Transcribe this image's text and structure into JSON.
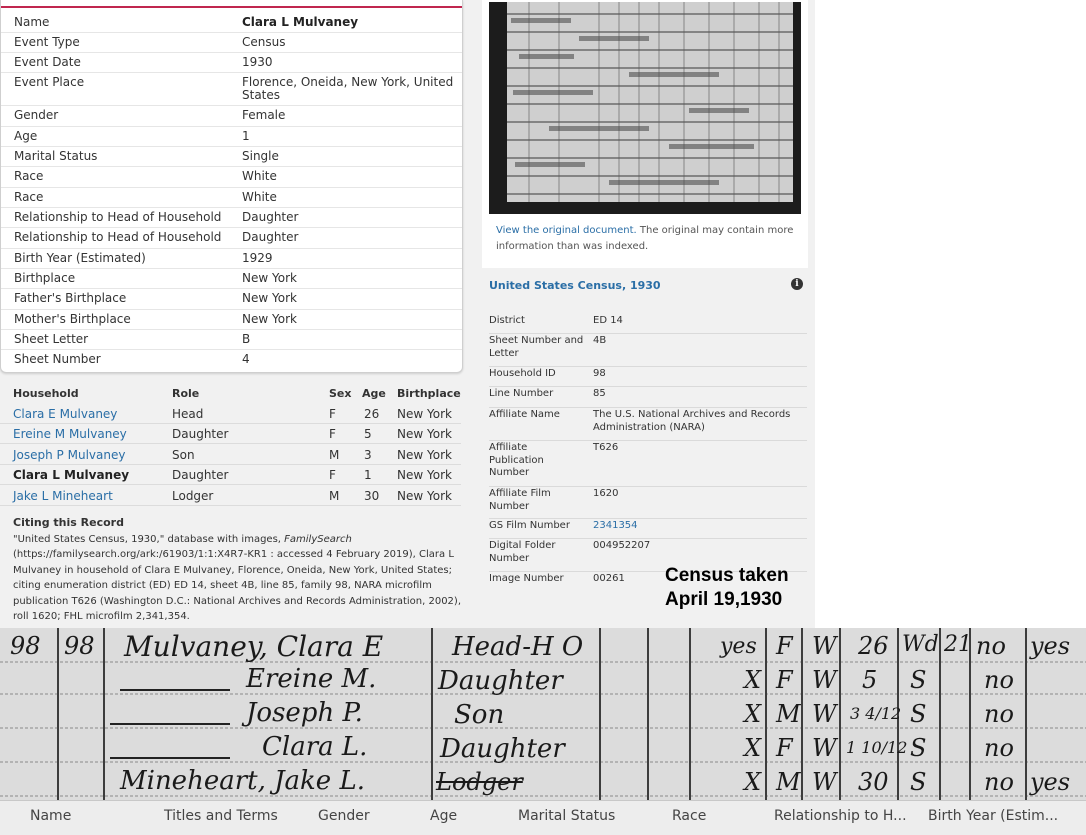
{
  "details": [
    {
      "label": "Name",
      "value": "Clara L Mulvaney",
      "bold": true
    },
    {
      "label": "Event Type",
      "value": "Census"
    },
    {
      "label": "Event Date",
      "value": "1930"
    },
    {
      "label": "Event Place",
      "value": "Florence, Oneida, New York, United States"
    },
    {
      "label": "Gender",
      "value": "Female"
    },
    {
      "label": "Age",
      "value": "1"
    },
    {
      "label": "Marital Status",
      "value": "Single"
    },
    {
      "label": "Race",
      "value": "White"
    },
    {
      "label": "Race",
      "value": "White"
    },
    {
      "label": "Relationship to Head of Household",
      "value": "Daughter"
    },
    {
      "label": "Relationship to Head of Household",
      "value": "Daughter"
    },
    {
      "label": "Birth Year (Estimated)",
      "value": "1929"
    },
    {
      "label": "Birthplace",
      "value": "New York"
    },
    {
      "label": "Father's Birthplace",
      "value": "New York"
    },
    {
      "label": "Mother's Birthplace",
      "value": "New York"
    },
    {
      "label": "Sheet Letter",
      "value": "B"
    },
    {
      "label": "Sheet Number",
      "value": "4"
    }
  ],
  "household": {
    "headers": {
      "name": "Household",
      "role": "Role",
      "sex": "Sex",
      "age": "Age",
      "birthplace": "Birthplace"
    },
    "rows": [
      {
        "name": "Clara E Mulvaney",
        "role": "Head",
        "sex": "F",
        "age": "26",
        "birthplace": "New York"
      },
      {
        "name": "Ereine M Mulvaney",
        "role": "Daughter",
        "sex": "F",
        "age": "5",
        "birthplace": "New York"
      },
      {
        "name": "Joseph P Mulvaney",
        "role": "Son",
        "sex": "M",
        "age": "3",
        "birthplace": "New York"
      },
      {
        "name": "Clara L Mulvaney",
        "role": "Daughter",
        "sex": "F",
        "age": "1",
        "birthplace": "New York",
        "current": true
      },
      {
        "name": "Jake L Mineheart",
        "role": "Lodger",
        "sex": "M",
        "age": "30",
        "birthplace": "New York"
      }
    ]
  },
  "citing": {
    "title": "Citing this Record",
    "text_before": "\"United States Census, 1930,\" database with images, ",
    "text_italic": "FamilySearch",
    "text_after": " (https://familysearch.org/ark:/61903/1:1:X4R7-KR1 : accessed 4 February 2019), Clara L Mulvaney in household of Clara E Mulvaney, Florence, Oneida, New York, United States; citing enumeration district (ED) ED 14, sheet 4B, line 85, family 98, NARA microfilm publication T626 (Washington D.C.: National Archives and Records Administration, 2002), roll 1620; FHL microfilm 2,341,354."
  },
  "image_panel": {
    "view_link": "View the original document.",
    "view_note": " The original may contain more information than was indexed."
  },
  "collection": {
    "title": "United States Census, 1930",
    "info_icon": "i",
    "rows": [
      {
        "label": "District",
        "value": "ED 14"
      },
      {
        "label": "Sheet Number and Letter",
        "value": "4B"
      },
      {
        "label": "Household ID",
        "value": "98"
      },
      {
        "label": "Line Number",
        "value": "85"
      },
      {
        "label": "Affiliate Name",
        "value": "The U.S. National Archives and Records Administration (NARA)"
      },
      {
        "label": "Affiliate Publication Number",
        "value": "T626"
      },
      {
        "label": "Affiliate Film Number",
        "value": "1620"
      },
      {
        "label": "GS Film Number",
        "value": "2341354",
        "link": true
      },
      {
        "label": "Digital Folder Number",
        "value": "004952207"
      },
      {
        "label": "Image Number",
        "value": "00261"
      }
    ]
  },
  "census_note": [
    "Census taken",
    "April 19,1930"
  ],
  "handwriting": {
    "row1": [
      "98",
      "98",
      "Mulvaney, Clara E",
      "Head-H O",
      "yes",
      "F",
      "W",
      "26",
      "Wd",
      "21",
      "no",
      "yes"
    ],
    "row2": [
      "Ereine M.",
      "Daughter",
      "X",
      "F",
      "W",
      "5",
      "S",
      "no"
    ],
    "row3": [
      "Joseph P.",
      "Son",
      "X",
      "M",
      "W",
      "3 4/12",
      "S",
      "no"
    ],
    "row4": [
      "Clara L.",
      "Daughter",
      "X",
      "F",
      "W",
      "1 10/12",
      "S",
      "no"
    ],
    "row5": [
      "Mineheart, Jake L.",
      "Lodger",
      "X",
      "M",
      "W",
      "30",
      "S",
      "no",
      "yes"
    ]
  },
  "column_bar": [
    "Name",
    "Titles and Terms",
    "Gender",
    "Age",
    "Marital Status",
    "Race",
    "Relationship to H...",
    "Birth Year (Estim..."
  ]
}
